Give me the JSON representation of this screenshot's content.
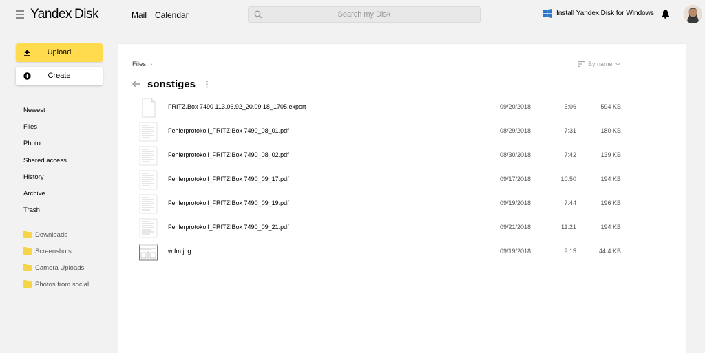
{
  "topbar": {
    "logo_yandex": "Yandex",
    "logo_disk": "Disk",
    "nav": [
      "Mail",
      "Calendar"
    ],
    "search_placeholder": "Search my Disk",
    "install_label": "Install Yandex.Disk for Windows"
  },
  "sidebar": {
    "upload_label": "Upload",
    "create_label": "Create",
    "items": [
      "Newest",
      "Files",
      "Photo",
      "Shared access",
      "History",
      "Archive",
      "Trash"
    ],
    "folders": [
      "Downloads",
      "Screenshots",
      "Camera Uploads",
      "Photos from social ..."
    ]
  },
  "main": {
    "breadcrumb": "Files",
    "sort_label": "By name",
    "folder_title": "sonstiges",
    "files": [
      {
        "name": "FRITZ.Box 7490 113.06.92_20.09.18_1705.export",
        "date": "09/20/2018",
        "time": "5:06",
        "size": "594 KB",
        "type": "doc"
      },
      {
        "name": "Fehlerprotokoll_FRITZ!Box 7490_08_01.pdf",
        "date": "08/29/2018",
        "time": "7:31",
        "size": "180 KB",
        "type": "pdf"
      },
      {
        "name": "Fehlerprotokoll_FRITZ!Box 7490_08_02.pdf",
        "date": "08/30/2018",
        "time": "7:42",
        "size": "139 KB",
        "type": "pdf"
      },
      {
        "name": "Fehlerprotokoll_FRITZ!Box 7490_09_17.pdf",
        "date": "09/17/2018",
        "time": "10:50",
        "size": "194 KB",
        "type": "pdf"
      },
      {
        "name": "Fehlerprotokoll_FRITZ!Box 7490_09_19.pdf",
        "date": "09/19/2018",
        "time": "7:44",
        "size": "196 KB",
        "type": "pdf"
      },
      {
        "name": "Fehlerprotokoll_FRITZ!Box 7490_09_21.pdf",
        "date": "09/21/2018",
        "time": "11:21",
        "size": "194 KB",
        "type": "pdf"
      },
      {
        "name": "wtfm.jpg",
        "date": "09/19/2018",
        "time": "9:15",
        "size": "44.4 KB",
        "type": "image"
      }
    ]
  },
  "colors": {
    "accent_yellow": "#ffdb4d",
    "folder_yellow": "#f5d44a",
    "logo_red": "#ff3333"
  }
}
